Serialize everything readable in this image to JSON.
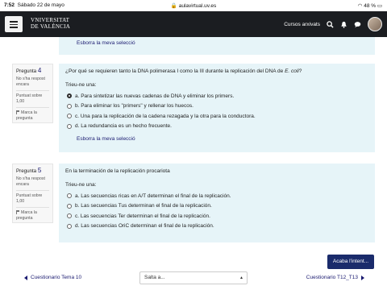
{
  "statusbar": {
    "time": "7:52",
    "date": "Sábado 22 de mayo",
    "url": "aulavirtual.uv.es",
    "battery": "48 %"
  },
  "navbar": {
    "logo_line1": "VNIVERSITAT",
    "logo_line2": "DE VALÈNCIA",
    "archived_courses": "Cursos arxivats"
  },
  "prev_question": {
    "clear_label": "Esborra la meva selecció"
  },
  "questions": [
    {
      "heading": "Pregunta",
      "number": "4",
      "status_line1": "No s'ha respost",
      "status_line2": "encara",
      "score_line1": "Puntuat sobre",
      "score_line2": "1,00",
      "flag_line1": "Marca la",
      "flag_line2": "pregunta",
      "text_prefix": "¿Por qué se requieren tanto la DNA polimerasa I como la III durante la replicación del DNA de ",
      "text_italic": "E. coli",
      "text_suffix": "?",
      "choose": "Trieu-ne una:",
      "answers": [
        "a. Para sintetizar las nuevas cadenas de DNA y eliminar los primers.",
        "b. Para eliminar los \"primers\" y rellenar los huecos.",
        "c. Una para la replicación de la cadena rezagada y la otra para la conductora.",
        "d. La redundancia es un hecho frecuente."
      ],
      "clear_label": "Esborra la meva selecció"
    },
    {
      "heading": "Pregunta",
      "number": "5",
      "status_line1": "No s'ha respost",
      "status_line2": "encara",
      "score_line1": "Puntuat sobre",
      "score_line2": "1,00",
      "flag_line1": "Marca la",
      "flag_line2": "pregunta",
      "text": "En la terminación de la replicación procariota",
      "choose": "Trieu-ne una:",
      "answers": [
        "a. Las secuencias ricas en A/T determinan el final de la replicación.",
        "b. Las secuencias Tus determinan el final de la replicación.",
        "c. Las secuencias Ter determinan el final de la replicación.",
        "d. Las secuencias OriC determinan el final de la replicación."
      ]
    }
  ],
  "footer": {
    "finish_label": "Acaba l'intent...",
    "prev_label": "Cuestionario Tema 10",
    "jump_label": "Salta a...",
    "next_label": "Cuestionario T12_T13"
  },
  "colors": {
    "navbar": "#1b1d21",
    "question_bg": "#e6f4f8",
    "link": "#1a1a70",
    "button": "#1a2b6b"
  }
}
